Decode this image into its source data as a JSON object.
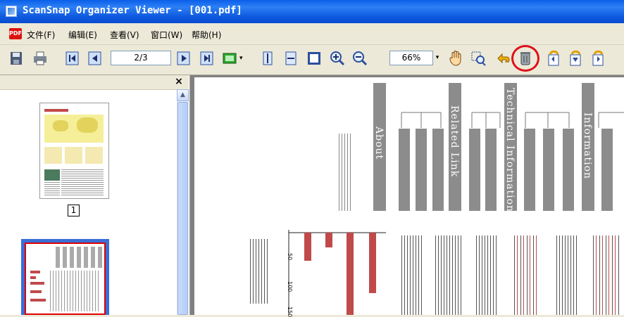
{
  "window": {
    "title": "ScanSnap Organizer Viewer - [001.pdf]"
  },
  "menu": {
    "file": "文件(F)",
    "edit": "编辑(E)",
    "view": "查看(V)",
    "window": "窗口(W)",
    "help": "帮助(H)"
  },
  "toolbar": {
    "page_value": "2/3",
    "zoom_value": "66%"
  },
  "thumbnails": {
    "page1_label": "1"
  },
  "document": {
    "headings": [
      "About",
      "Related Link",
      "Technical Information",
      "Information"
    ],
    "chart_ticks": [
      "50",
      "100",
      "150"
    ]
  },
  "colors": {
    "titlebar": "#0A5FE8",
    "highlight": "#E0101A",
    "chart_bar": "#C04A4A"
  }
}
